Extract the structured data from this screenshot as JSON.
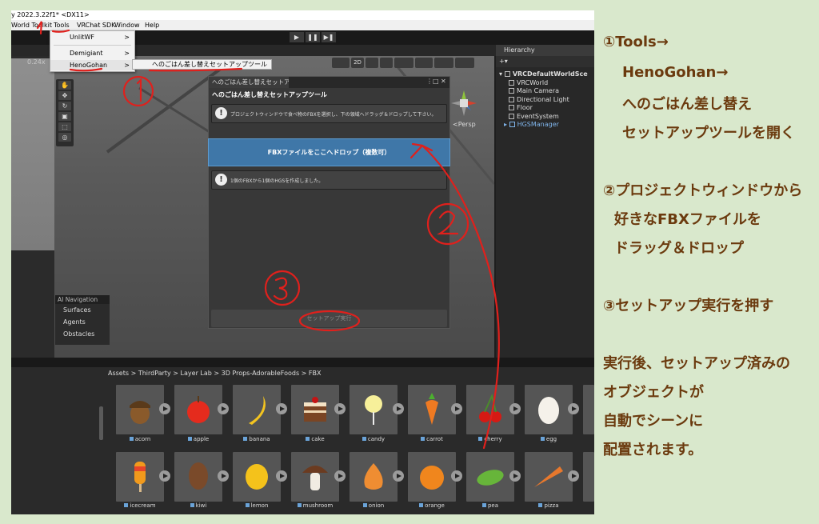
{
  "window": {
    "title": "y 2022.3.22f1* <DX11>"
  },
  "menubar": [
    "World Toolkit",
    "Tools",
    "VRChat SDK",
    "Window",
    "Help"
  ],
  "toolbar": {
    "play": "▶",
    "pause": "❚❚",
    "step": "▶❚"
  },
  "scene": {
    "zoom": "0.24x",
    "persp": "<Persp",
    "mode_2d": "2D"
  },
  "tools_menu": {
    "items": [
      {
        "label": "UnlitWF",
        "arrow": ">"
      },
      {
        "label": "Demigiant",
        "arrow": ">"
      },
      {
        "label": "HenoGohan",
        "arrow": ">"
      }
    ],
    "submenu": "へのごはん差し替えセットアップツール"
  },
  "setup_window": {
    "tab": "へのごはん差し替えセットアッ...",
    "heading": "へのごはん差し替えセットアップツール",
    "info1": "プロジェクトウィンドウで食べ物のFBXを選択し、下の領域へドラッグ＆ドロップして下さい。",
    "drop_label": "FBXファイルをここへドロップ（複数可）",
    "info2": "1個のFBXから1個のHGSを作成しました。",
    "exec_label": "セットアップ実行"
  },
  "ai_navigation": {
    "title": "AI Navigation",
    "items": [
      "Surfaces",
      "Agents",
      "Obstacles"
    ]
  },
  "hierarchy": {
    "tab": "Hierarchy",
    "plus": "+▾",
    "root": "VRCDefaultWorldSce",
    "children": [
      "VRCWorld",
      "Main Camera",
      "Directional Light",
      "Floor",
      "EventSystem"
    ],
    "selected": "HGSManager"
  },
  "project": {
    "breadcrumb": "Assets  >  ThirdParty  >  Layer Lab  >  3D Props-AdorableFoods  >  FBX",
    "assets_row1": [
      "acorn",
      "apple",
      "banana",
      "cake",
      "candy",
      "carrot",
      "cherry",
      "egg"
    ],
    "assets_row2": [
      "icecream",
      "kiwi",
      "lemon",
      "mushroom",
      "onion",
      "orange",
      "pea",
      "pizza"
    ]
  },
  "annotations": {
    "n1": "1",
    "c1": "①",
    "c2": "②",
    "c3": "③"
  },
  "notes": {
    "l1": "①Tools→",
    "l2": "HenoGohan→",
    "l3": "へのごはん差し替え",
    "l4": "セットアップツールを開く",
    "l5": "②プロジェクトウィンドウから",
    "l6": "好きなFBXファイルを",
    "l7": "ドラッグ＆ドロップ",
    "l8": "③セットアップ実行を押す",
    "l9": "実行後、セットアップ済みの",
    "l10": "オブジェクトが",
    "l11": "自動でシーンに",
    "l12": "配置されます。"
  },
  "colors": {
    "accent_red": "#e0201c",
    "drop_blue": "#3f77a8",
    "note_brown": "#6b3a0e",
    "background": "#d9e8cc"
  }
}
